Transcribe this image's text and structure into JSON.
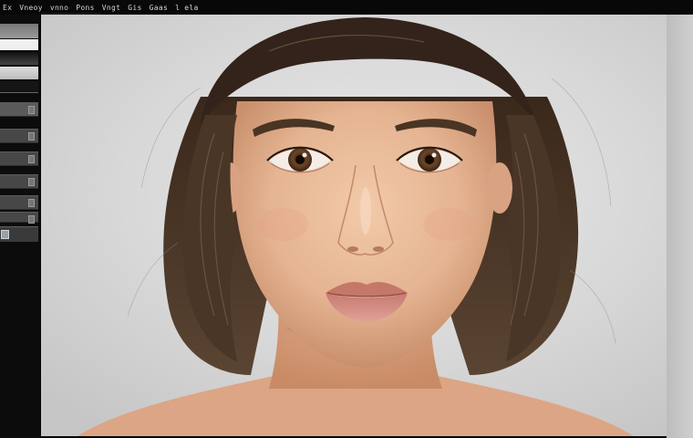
{
  "menubar": {
    "items": [
      {
        "label": "Ex"
      },
      {
        "label": "Vneoy"
      },
      {
        "label": "vnno"
      },
      {
        "label": "Pons"
      },
      {
        "label": "Vngt"
      },
      {
        "label": "Gis"
      },
      {
        "label": "Gaas"
      },
      {
        "label": "l ela"
      }
    ]
  },
  "left_panel": {
    "slider_count": 6,
    "swatches": [
      "#8a8a8a",
      "#f2f2f2",
      "#202020",
      "#d8d8d8",
      "#1a1a1a"
    ]
  },
  "canvas": {
    "subject": "portrait-photo",
    "background_color": "#dcdcdc",
    "hair_color": "#3b2a1e",
    "skin_color": "#e7b99a",
    "eye_color": "#5a3a22",
    "lip_color": "#d88f85"
  }
}
